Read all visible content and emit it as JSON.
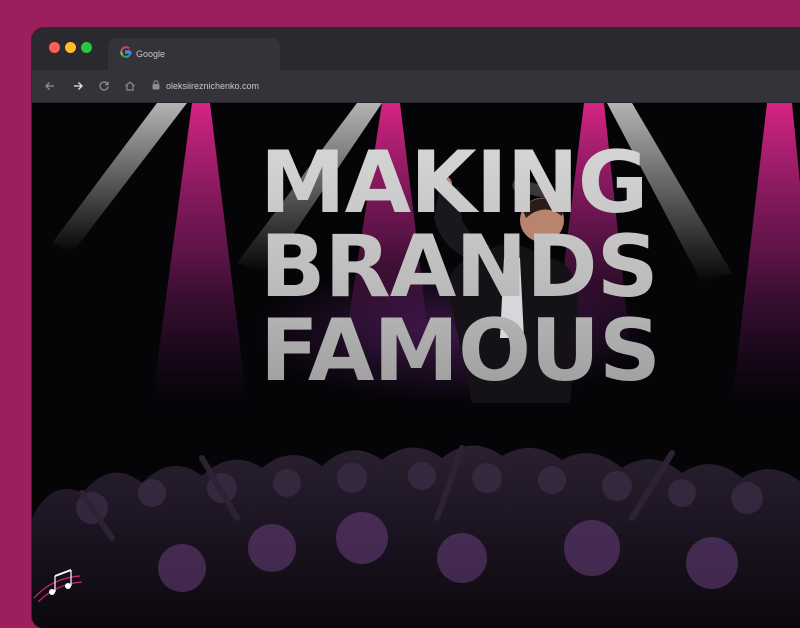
{
  "browser": {
    "tab_title": "Google",
    "tab_icon": "google-g-icon",
    "url": "oleksiireznichenko.com",
    "controls": [
      "back-arrow-icon",
      "forward-arrow-icon",
      "reload-icon",
      "home-icon",
      "lock-icon"
    ]
  },
  "page": {
    "headline_line1": "MAKING",
    "headline_line2": "BRANDS",
    "headline_line3": "FAMOUS",
    "hero_image": "singer-with-microphone-over-concert-crowd",
    "decor_icon": "music-notes-icon"
  },
  "colors": {
    "frame": "#9b1f5c",
    "stage_light": "#d0207a",
    "headline": "#c8c8c8"
  }
}
